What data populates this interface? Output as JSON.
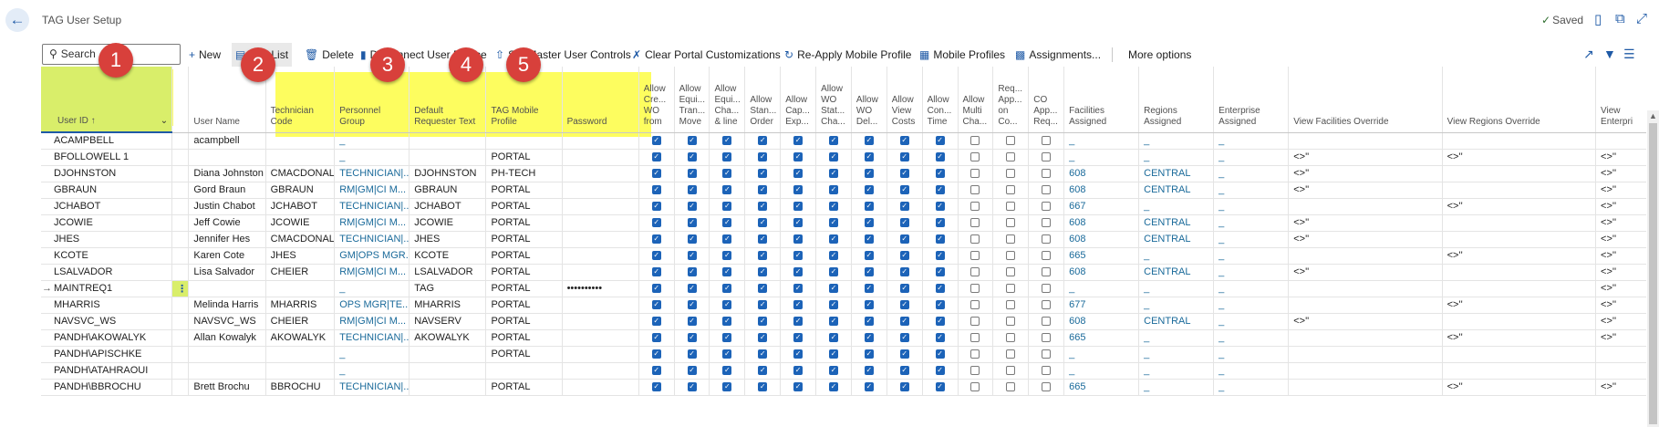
{
  "page": {
    "title": "TAG User Setup",
    "status": "Saved"
  },
  "toolbar": {
    "search_placeholder": "Search",
    "new": "New",
    "edit_list": "Edit List",
    "delete": "Delete",
    "disconnect": "Disconnect User Device",
    "set_master": "Set Master User Controls",
    "clear_portal": "Clear Portal Customizations",
    "reapply": "Re-Apply Mobile Profile",
    "mobile_profiles": "Mobile Profiles",
    "assignments": "Assignments...",
    "more": "More options"
  },
  "markers": [
    "1",
    "2",
    "3",
    "4",
    "5"
  ],
  "columns": [
    {
      "label": "User ID ↑",
      "type": "text"
    },
    {
      "label": "",
      "type": "text"
    },
    {
      "label": "User Name",
      "type": "text"
    },
    {
      "label": "Technician Code",
      "type": "text"
    },
    {
      "label": "Personnel Group",
      "type": "text"
    },
    {
      "label": "Default Requester Text",
      "type": "text"
    },
    {
      "label": "TAG Mobile Profile",
      "type": "text"
    },
    {
      "label": "Password",
      "type": "text"
    },
    {
      "label": "Allow Cre... WO from",
      "type": "cb"
    },
    {
      "label": "Allow Equi... Tran... Move",
      "type": "cb"
    },
    {
      "label": "Allow Equi... Cha... & line",
      "type": "cb"
    },
    {
      "label": "Allow Stan... Order",
      "type": "cb"
    },
    {
      "label": "Allow Cap... Exp...",
      "type": "cb"
    },
    {
      "label": "Allow WO Stat... Cha...",
      "type": "cb"
    },
    {
      "label": "Allow WO Del...",
      "type": "cb"
    },
    {
      "label": "Allow View Costs",
      "type": "cb"
    },
    {
      "label": "Allow Con... Time",
      "type": "cb"
    },
    {
      "label": "Allow Multi Cha...",
      "type": "cb"
    },
    {
      "label": "Req... App... on Co...",
      "type": "cb"
    },
    {
      "label": "CO App... Req...",
      "type": "cb"
    },
    {
      "label": "Facilities Assigned",
      "type": "text"
    },
    {
      "label": "Regions Assigned",
      "type": "text"
    },
    {
      "label": "Enterprise Assigned",
      "type": "text"
    },
    {
      "label": "View Facilities Override",
      "type": "text"
    },
    {
      "label": "View Regions Override",
      "type": "text"
    },
    {
      "label": "View Enterpri",
      "type": "text"
    }
  ],
  "rows": [
    {
      "marker": "",
      "menu": "",
      "user_id": "ACAMPBELL",
      "user_name": "acampbell",
      "tech_code": "",
      "personnel_group": "_",
      "requester": "",
      "profile": "",
      "password": "",
      "checks": [
        1,
        1,
        1,
        1,
        1,
        1,
        1,
        1,
        1,
        0,
        0,
        0
      ],
      "facilities": "_",
      "regions": "_",
      "enterprise": "_",
      "view_fac": "",
      "view_reg": "",
      "view_ent": ""
    },
    {
      "marker": "",
      "menu": "",
      "user_id": "BFOLLOWELL 1",
      "user_name": "",
      "tech_code": "",
      "personnel_group": "_",
      "requester": "",
      "profile": "PORTAL",
      "password": "",
      "checks": [
        1,
        1,
        1,
        1,
        1,
        1,
        1,
        1,
        1,
        0,
        0,
        0
      ],
      "facilities": "_",
      "regions": "_",
      "enterprise": "_",
      "view_fac": "<>''",
      "view_reg": "<>''",
      "view_ent": "<>''"
    },
    {
      "marker": "",
      "menu": "",
      "user_id": "DJOHNSTON",
      "user_name": "Diana Johnston",
      "tech_code": "CMACDONALD",
      "personnel_group": "TECHNICIAN|...",
      "requester": "DJOHNSTON",
      "profile": "PH-TECH",
      "password": "",
      "checks": [
        1,
        1,
        1,
        1,
        1,
        1,
        1,
        1,
        1,
        0,
        0,
        0
      ],
      "facilities": "608",
      "regions": "CENTRAL",
      "enterprise": "_",
      "view_fac": "<>''",
      "view_reg": "",
      "view_ent": "<>''"
    },
    {
      "marker": "",
      "menu": "",
      "user_id": "GBRAUN",
      "user_name": "Gord Braun",
      "tech_code": "GBRAUN",
      "personnel_group": "RM|GM|CI M...",
      "requester": "GBRAUN",
      "profile": "PORTAL",
      "password": "",
      "checks": [
        1,
        1,
        1,
        1,
        1,
        1,
        1,
        1,
        1,
        0,
        0,
        0
      ],
      "facilities": "608",
      "regions": "CENTRAL",
      "enterprise": "_",
      "view_fac": "<>''",
      "view_reg": "",
      "view_ent": "<>''"
    },
    {
      "marker": "",
      "menu": "",
      "user_id": "JCHABOT",
      "user_name": "Justin Chabot",
      "tech_code": "JCHABOT",
      "personnel_group": "TECHNICIAN|...",
      "requester": "JCHABOT",
      "profile": "PORTAL",
      "password": "",
      "checks": [
        1,
        1,
        1,
        1,
        1,
        1,
        1,
        1,
        1,
        0,
        0,
        0
      ],
      "facilities": "667",
      "regions": "_",
      "enterprise": "_",
      "view_fac": "",
      "view_reg": "<>''",
      "view_ent": "<>''"
    },
    {
      "marker": "",
      "menu": "",
      "user_id": "JCOWIE",
      "user_name": "Jeff Cowie",
      "tech_code": "JCOWIE",
      "personnel_group": "RM|GM|CI M...",
      "requester": "JCOWIE",
      "profile": "PORTAL",
      "password": "",
      "checks": [
        1,
        1,
        1,
        1,
        1,
        1,
        1,
        1,
        1,
        0,
        0,
        0
      ],
      "facilities": "608",
      "regions": "CENTRAL",
      "enterprise": "_",
      "view_fac": "<>''",
      "view_reg": "",
      "view_ent": "<>''"
    },
    {
      "marker": "",
      "menu": "",
      "user_id": "JHES",
      "user_name": "Jennifer Hes",
      "tech_code": "CMACDONALD",
      "personnel_group": "TECHNICIAN|...",
      "requester": "JHES",
      "profile": "PORTAL",
      "password": "",
      "checks": [
        1,
        1,
        1,
        1,
        1,
        1,
        1,
        1,
        1,
        0,
        0,
        0
      ],
      "facilities": "608",
      "regions": "CENTRAL",
      "enterprise": "_",
      "view_fac": "<>''",
      "view_reg": "",
      "view_ent": "<>''"
    },
    {
      "marker": "",
      "menu": "",
      "user_id": "KCOTE",
      "user_name": "Karen Cote",
      "tech_code": "JHES",
      "personnel_group": "GM|OPS MGR...",
      "requester": "KCOTE",
      "profile": "PORTAL",
      "password": "",
      "checks": [
        1,
        1,
        1,
        1,
        1,
        1,
        1,
        1,
        1,
        0,
        0,
        0
      ],
      "facilities": "665",
      "regions": "_",
      "enterprise": "_",
      "view_fac": "",
      "view_reg": "<>''",
      "view_ent": "<>''"
    },
    {
      "marker": "",
      "menu": "",
      "user_id": "LSALVADOR",
      "user_name": "Lisa Salvador",
      "tech_code": "CHEIER",
      "personnel_group": "RM|GM|CI M...",
      "requester": "LSALVADOR",
      "profile": "PORTAL",
      "password": "",
      "checks": [
        1,
        1,
        1,
        1,
        1,
        1,
        1,
        1,
        1,
        0,
        0,
        0
      ],
      "facilities": "608",
      "regions": "CENTRAL",
      "enterprise": "_",
      "view_fac": "<>''",
      "view_reg": "",
      "view_ent": "<>''"
    },
    {
      "marker": "→",
      "menu": "⋮",
      "user_id": "MAINTREQ1",
      "user_name": "",
      "tech_code": "",
      "personnel_group": "_",
      "requester": "TAG",
      "profile": "PORTAL",
      "password": "••••••••••",
      "checks": [
        1,
        1,
        1,
        1,
        1,
        1,
        1,
        1,
        1,
        0,
        0,
        0
      ],
      "facilities": "_",
      "regions": "_",
      "enterprise": "_",
      "view_fac": "",
      "view_reg": "",
      "view_ent": "<>''"
    },
    {
      "marker": "",
      "menu": "",
      "user_id": "MHARRIS",
      "user_name": "Melinda Harris",
      "tech_code": "MHARRIS",
      "personnel_group": "OPS MGR|TE...",
      "requester": "MHARRIS",
      "profile": "PORTAL",
      "password": "",
      "checks": [
        1,
        1,
        1,
        1,
        1,
        1,
        1,
        1,
        1,
        0,
        0,
        0
      ],
      "facilities": "677",
      "regions": "_",
      "enterprise": "_",
      "view_fac": "",
      "view_reg": "<>''",
      "view_ent": "<>''"
    },
    {
      "marker": "",
      "menu": "",
      "user_id": "NAVSVC_WS",
      "user_name": "NAVSVC_WS",
      "tech_code": "CHEIER",
      "personnel_group": "RM|GM|CI M...",
      "requester": "NAVSERV",
      "profile": "PORTAL",
      "password": "",
      "checks": [
        1,
        1,
        1,
        1,
        1,
        1,
        1,
        1,
        1,
        0,
        0,
        0
      ],
      "facilities": "608",
      "regions": "CENTRAL",
      "enterprise": "_",
      "view_fac": "<>''",
      "view_reg": "",
      "view_ent": "<>''"
    },
    {
      "marker": "",
      "menu": "",
      "user_id": "PANDH\\AKOWALYK",
      "user_name": "Allan Kowalyk",
      "tech_code": "AKOWALYK",
      "personnel_group": "TECHNICIAN|...",
      "requester": "AKOWALYK",
      "profile": "PORTAL",
      "password": "",
      "checks": [
        1,
        1,
        1,
        1,
        1,
        1,
        1,
        1,
        1,
        0,
        0,
        0
      ],
      "facilities": "665",
      "regions": "_",
      "enterprise": "_",
      "view_fac": "",
      "view_reg": "<>''",
      "view_ent": "<>''"
    },
    {
      "marker": "",
      "menu": "",
      "user_id": "PANDH\\APISCHKE",
      "user_name": "",
      "tech_code": "",
      "personnel_group": "_",
      "requester": "",
      "profile": "PORTAL",
      "password": "",
      "checks": [
        1,
        1,
        1,
        1,
        1,
        1,
        1,
        1,
        1,
        0,
        0,
        0
      ],
      "facilities": "_",
      "regions": "_",
      "enterprise": "_",
      "view_fac": "",
      "view_reg": "",
      "view_ent": ""
    },
    {
      "marker": "",
      "menu": "",
      "user_id": "PANDH\\ATAHRAOUI",
      "user_name": "",
      "tech_code": "",
      "personnel_group": "_",
      "requester": "",
      "profile": "",
      "password": "",
      "checks": [
        1,
        1,
        1,
        1,
        1,
        1,
        1,
        1,
        1,
        0,
        0,
        0
      ],
      "facilities": "_",
      "regions": "_",
      "enterprise": "_",
      "view_fac": "",
      "view_reg": "",
      "view_ent": ""
    },
    {
      "marker": "",
      "menu": "",
      "user_id": "PANDH\\BBROCHU",
      "user_name": "Brett Brochu",
      "tech_code": "BBROCHU",
      "personnel_group": "TECHNICIAN|...",
      "requester": "",
      "profile": "PORTAL",
      "password": "",
      "checks": [
        1,
        1,
        1,
        1,
        1,
        1,
        1,
        1,
        1,
        0,
        0,
        0
      ],
      "facilities": "665",
      "regions": "_",
      "enterprise": "_",
      "view_fac": "",
      "view_reg": "<>''",
      "view_ent": "<>''"
    }
  ]
}
